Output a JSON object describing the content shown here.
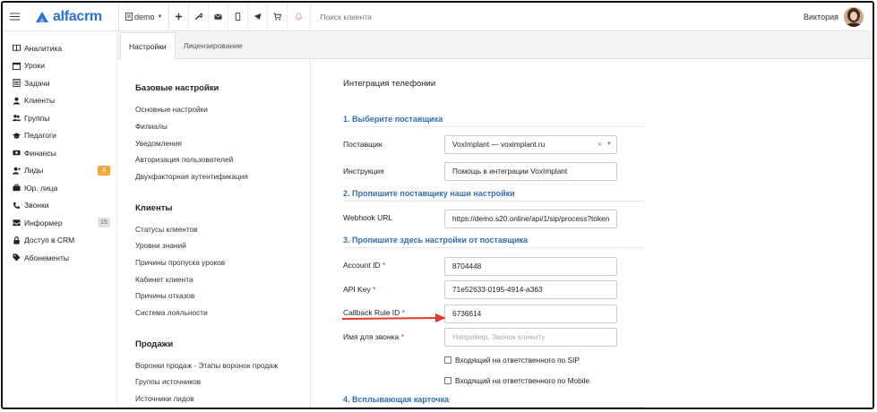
{
  "topbar": {
    "logo_text": "alfacrm",
    "branch": "demo",
    "search_placeholder": "Поиск клиента",
    "user_name": "Виктория"
  },
  "sidebar": {
    "items": [
      {
        "label": "Аналитика",
        "icon": "book-icon"
      },
      {
        "label": "Уроки",
        "icon": "calendar-icon"
      },
      {
        "label": "Задачи",
        "icon": "checklist-icon"
      },
      {
        "label": "Клиенты",
        "icon": "user-icon"
      },
      {
        "label": "Группы",
        "icon": "users-icon"
      },
      {
        "label": "Педагоги",
        "icon": "graduation-cap-icon"
      },
      {
        "label": "Финансы",
        "icon": "money-icon"
      },
      {
        "label": "Лиды",
        "icon": "user-plus-icon",
        "badge": "3"
      },
      {
        "label": "Юр. лица",
        "icon": "briefcase-icon"
      },
      {
        "label": "Звонки",
        "icon": "phone-icon"
      },
      {
        "label": "Информер",
        "icon": "inbox-icon",
        "badge": "15"
      },
      {
        "label": "Доступ в CRM",
        "icon": "lock-icon"
      },
      {
        "label": "Абонементы",
        "icon": "tag-icon"
      }
    ]
  },
  "tabs": [
    {
      "label": "Настройки",
      "active": true
    },
    {
      "label": "Лицензирование",
      "active": false
    }
  ],
  "menu": {
    "groups": [
      {
        "title": "Базовые настройки",
        "items": [
          "Основные настройки",
          "Филиалы",
          "Уведомления",
          "Авторизация пользователей",
          "Двухфакторная аутентификация"
        ]
      },
      {
        "title": "Клиенты",
        "items": [
          "Статусы клиентов",
          "Уровни знаний",
          "Причины пропуска уроков",
          "Кабинет клиента",
          "Причины отказов",
          "Система лояльности"
        ]
      },
      {
        "title": "Продажи",
        "items": [
          "Воронки продаж - Этапы воронок продаж",
          "Группы источников",
          "Источники лидов"
        ]
      }
    ]
  },
  "content": {
    "title": "Интеграция телефонии",
    "section1": "1. Выберите поставщика",
    "provider_label": "Поставщик",
    "provider_value": "VoxImplant — voximplant.ru",
    "instruction_label": "Инструкция",
    "instruction_value": "Помощь в интеграции VoxImplant",
    "section2": "2. Пропишите поставщику наши настройки",
    "webhook_label": "Webhook URL",
    "webhook_value": "https://demo.s20.online/api/1/sip/process?token",
    "section3": "3. Пропишите здесь настройки от поставщика",
    "account_label": "Account ID",
    "account_value": "8704448",
    "apikey_label": "API Key",
    "apikey_value": "71e52633-0195-4914-a363",
    "callback_label": "Callback Rule ID",
    "callback_value": "6736614",
    "callname_label": "Имя для звонка",
    "callname_placeholder": "Например, Звонок клиенту",
    "check_sip": "Входящий на ответственного по SIP",
    "check_mobile": "Входящий на ответственного по Mobile",
    "section4": "4. Всплывающая карточка",
    "required_mark": "*"
  },
  "colors": {
    "accent": "#2a6fdb",
    "section": "#2f6fb0",
    "arrow": "#e23b2e",
    "badge_orange": "#f4a93a"
  }
}
